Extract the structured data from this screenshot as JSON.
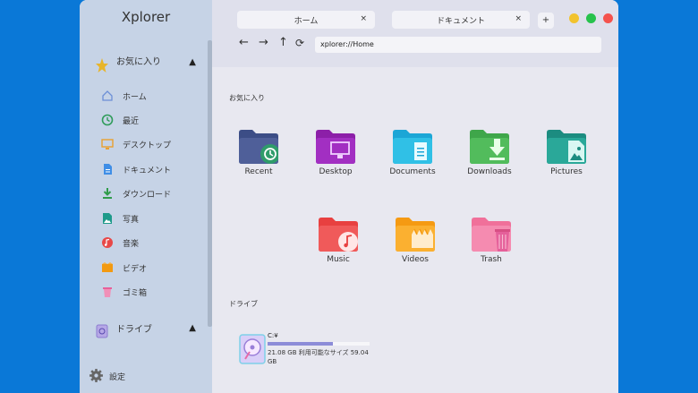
{
  "app": {
    "title": "Xplorer"
  },
  "sidebar": {
    "favorites": {
      "label": "お気に入り",
      "caret": "▲"
    },
    "items": [
      {
        "label": "ホーム",
        "icon": "home-icon"
      },
      {
        "label": "最近",
        "icon": "recent-icon"
      },
      {
        "label": "デスクトップ",
        "icon": "desktop-icon"
      },
      {
        "label": "ドキュメント",
        "icon": "document-icon"
      },
      {
        "label": "ダウンロード",
        "icon": "download-icon"
      },
      {
        "label": "写真",
        "icon": "picture-icon"
      },
      {
        "label": "音楽",
        "icon": "music-icon"
      },
      {
        "label": "ビデオ",
        "icon": "video-icon"
      },
      {
        "label": "ゴミ箱",
        "icon": "trash-icon"
      }
    ],
    "drives": {
      "label": "ドライブ",
      "caret": "▲"
    },
    "settings": {
      "label": "設定"
    }
  },
  "tabs": [
    {
      "label": "ホーム",
      "close": "×"
    },
    {
      "label": "ドキュメント",
      "close": "×"
    }
  ],
  "new_tab": "+",
  "window_controls": {
    "minimize": "#f2c32e",
    "maximize": "#27c24c",
    "close": "#f4524d"
  },
  "navigation": {
    "back": "←",
    "forward": "→",
    "up": "↑",
    "refresh": "⟳"
  },
  "address": {
    "value": "xplorer://Home"
  },
  "main": {
    "favorites_label": "お気に入り",
    "folders": [
      {
        "label": "Recent",
        "color": "#3c4d86",
        "icon": "recent-folder-icon"
      },
      {
        "label": "Desktop",
        "color": "#8c1fa8",
        "icon": "desktop-folder-icon"
      },
      {
        "label": "Documents",
        "color": "#1ca6d6",
        "icon": "documents-folder-icon"
      },
      {
        "label": "Downloads",
        "color": "#3fa64a",
        "icon": "downloads-folder-icon"
      },
      {
        "label": "Pictures",
        "color": "#1c8c80",
        "icon": "pictures-folder-icon"
      },
      {
        "label": "Music",
        "color": "#ea4a4a",
        "icon": "music-folder-icon"
      },
      {
        "label": "Videos",
        "color": "#f59a12",
        "icon": "videos-folder-icon"
      },
      {
        "label": "Trash",
        "color": "#f2709a",
        "icon": "trash-folder-icon"
      }
    ],
    "drives_label": "ドライブ",
    "drive": {
      "name": "C:¥",
      "info": "21.08 GB 利用可能なサイズ 59.04 GB",
      "used_fraction": 0.64
    }
  }
}
